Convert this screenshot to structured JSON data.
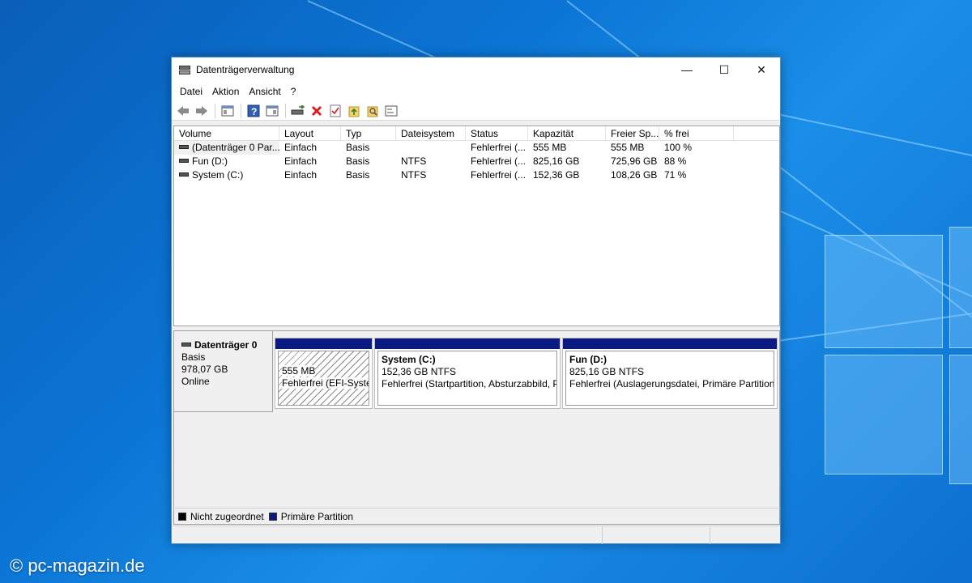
{
  "window": {
    "title": "Datenträgerverwaltung",
    "controls": {
      "minimize": "—",
      "maximize": "☐",
      "close": "✕"
    }
  },
  "menu": [
    "Datei",
    "Aktion",
    "Ansicht",
    "?"
  ],
  "toolbar": {
    "icons": [
      "back-arrow-icon",
      "forward-arrow-icon",
      "console-tree-icon",
      "help-icon",
      "properties-icon",
      "connect-icon",
      "delete-icon",
      "checklist-icon",
      "new-folder-icon",
      "search-folder-icon",
      "settings-icon"
    ],
    "delete_color": "#d81e1e"
  },
  "table": {
    "columns": [
      "Volume",
      "Layout",
      "Typ",
      "Dateisystem",
      "Status",
      "Kapazität",
      "Freier Sp...",
      "% frei"
    ],
    "rows": [
      {
        "volume": "(Datenträger 0 Par...",
        "layout": "Einfach",
        "typ": "Basis",
        "fs": "",
        "status": "Fehlerfrei (...",
        "kap": "555 MB",
        "frei": "555 MB",
        "pct": "100 %"
      },
      {
        "volume": "Fun (D:)",
        "layout": "Einfach",
        "typ": "Basis",
        "fs": "NTFS",
        "status": "Fehlerfrei (...",
        "kap": "825,16 GB",
        "frei": "725,96 GB",
        "pct": "88 %"
      },
      {
        "volume": "System (C:)",
        "layout": "Einfach",
        "typ": "Basis",
        "fs": "NTFS",
        "status": "Fehlerfrei (...",
        "kap": "152,36 GB",
        "frei": "108,26 GB",
        "pct": "71 %"
      }
    ]
  },
  "disk": {
    "name": "Datenträger 0",
    "type": "Basis",
    "size": "978,07 GB",
    "state": "Online"
  },
  "partitions": [
    {
      "name": "",
      "size": "555 MB",
      "status": "Fehlerfrei (EFI-Systempartition)"
    },
    {
      "name": "System  (C:)",
      "size": "152,36 GB NTFS",
      "status": "Fehlerfrei (Startpartition, Absturzabbild, Primäre Partition)"
    },
    {
      "name": "Fun  (D:)",
      "size": "825,16 GB NTFS",
      "status": "Fehlerfrei (Auslagerungsdatei, Primäre Partition)"
    }
  ],
  "legend": [
    {
      "label": "Nicht zugeordnet",
      "color": "#000000"
    },
    {
      "label": "Primäre Partition",
      "color": "#0a1a82"
    }
  ],
  "watermark": "© pc-magazin.de"
}
